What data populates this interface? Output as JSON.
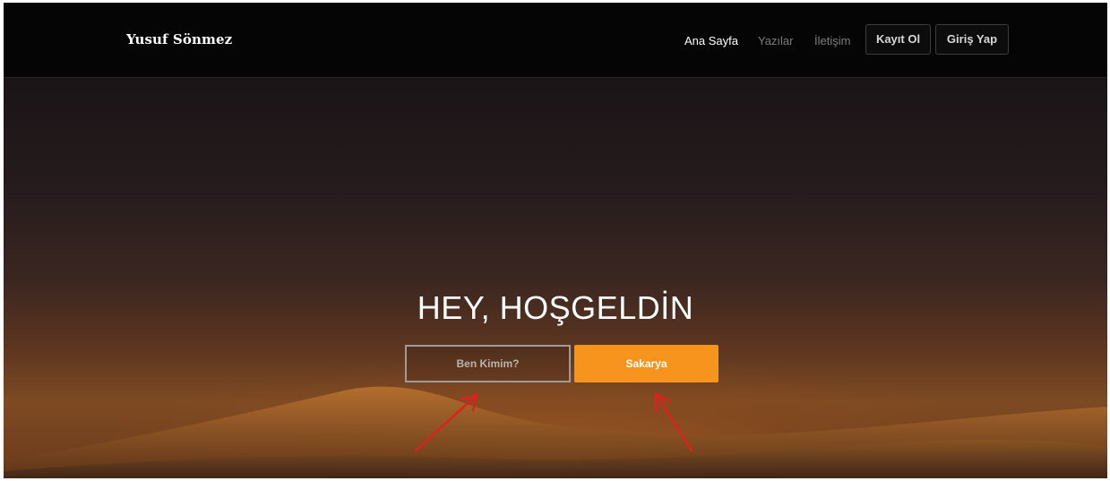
{
  "navbar": {
    "brand": "Yusuf Sönmez",
    "links": [
      {
        "label": "Ana Sayfa",
        "active": true
      },
      {
        "label": "Yazılar",
        "active": false
      },
      {
        "label": "İletişim",
        "active": false
      }
    ],
    "buttons": [
      {
        "label": "Kayıt Ol"
      },
      {
        "label": "Giriş Yap"
      }
    ]
  },
  "hero": {
    "title": "HEY, HOŞGELDİN",
    "secondary_button": "Ben Kimim?",
    "primary_button": "Sakarya"
  },
  "colors": {
    "accent": "#f7941d",
    "navbar_bg": "#050505",
    "annotation_arrow": "#e0201c"
  },
  "annotations": {
    "arrows": [
      "red-arrow-icon",
      "red-arrow-icon"
    ]
  }
}
